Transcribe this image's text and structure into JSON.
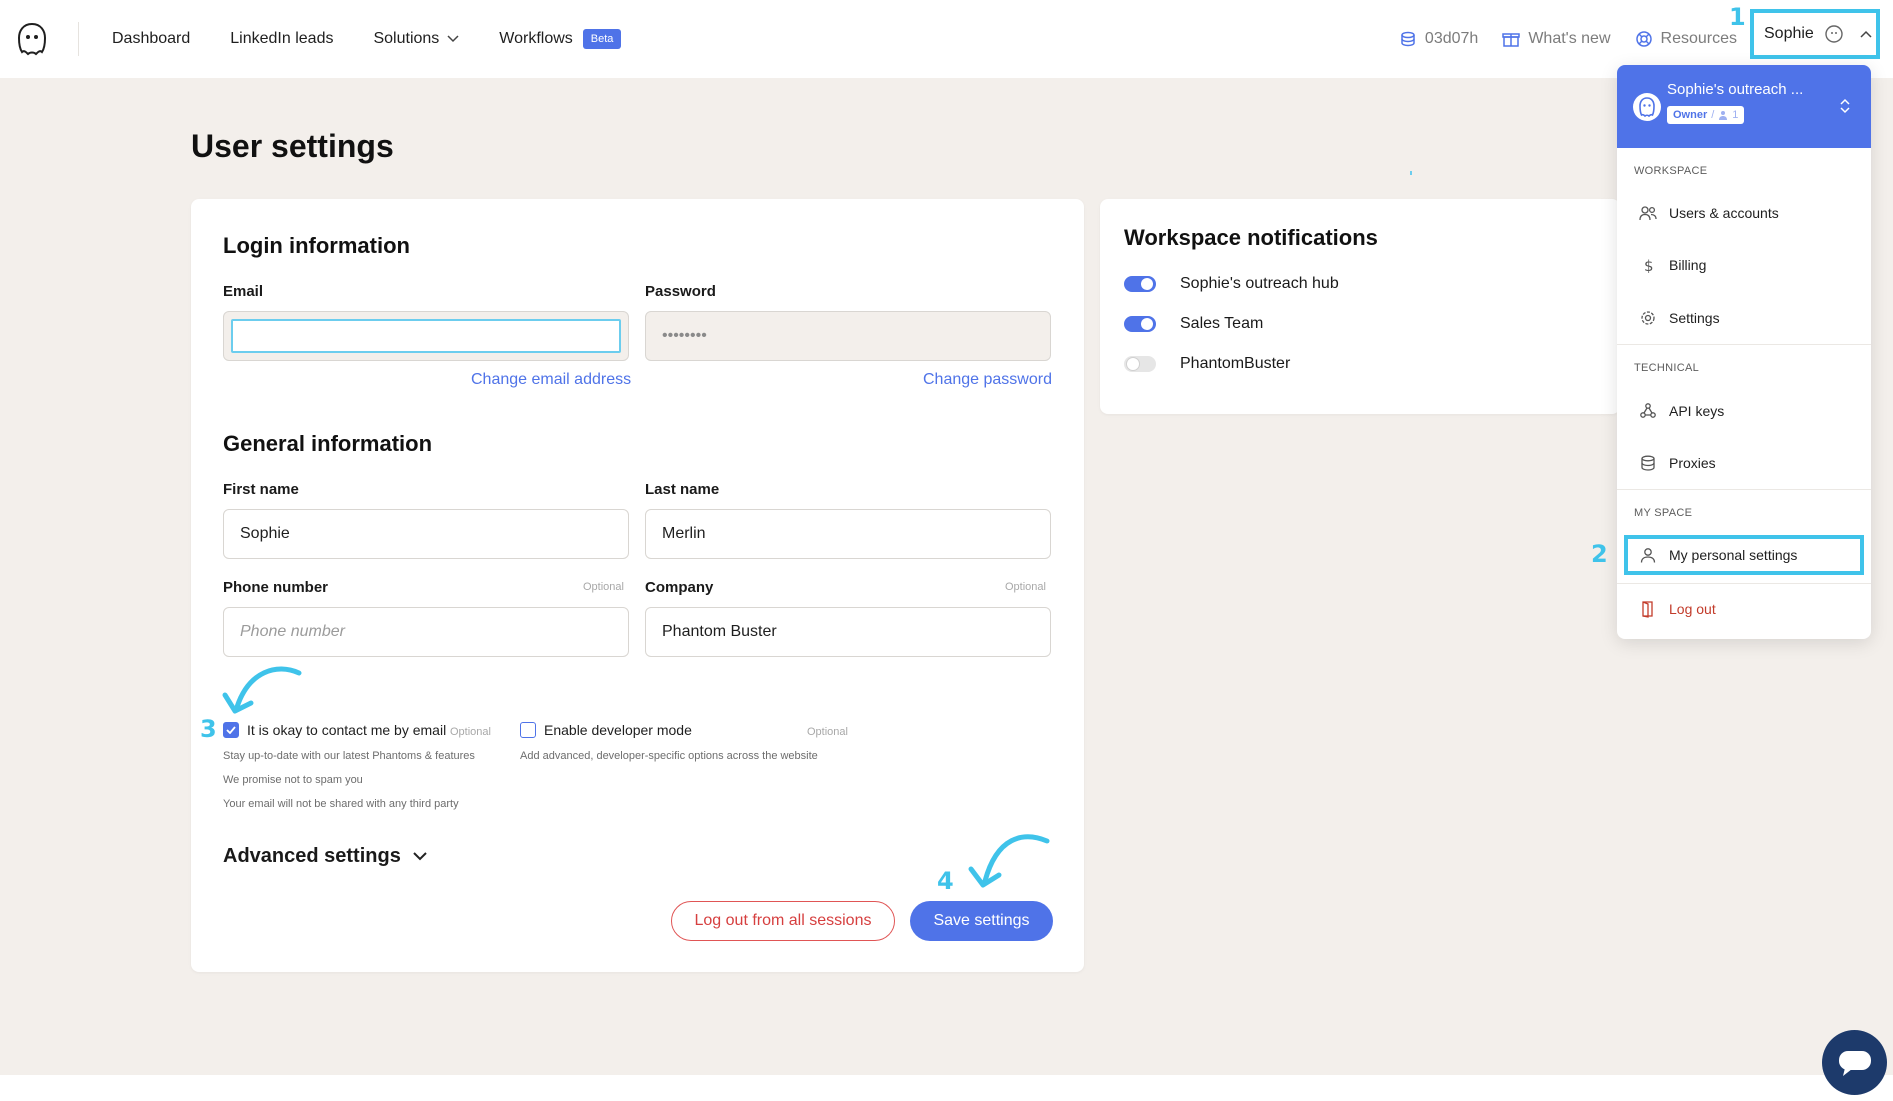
{
  "nav": {
    "links": [
      {
        "label": "Dashboard"
      },
      {
        "label": "LinkedIn leads"
      },
      {
        "label": "Solutions"
      },
      {
        "label": "Workflows",
        "badge": "Beta"
      }
    ],
    "time_remaining": "03d07h",
    "whats_new": "What's new",
    "resources": "Resources",
    "user_name": "Sophie"
  },
  "annotations": {
    "one": "1",
    "two": "2",
    "three": "3",
    "four": "4"
  },
  "page": {
    "title": "User settings"
  },
  "login": {
    "section_title": "Login information",
    "email_label": "Email",
    "email_value": "",
    "password_label": "Password",
    "password_value": "••••••••",
    "change_email": "Change email address",
    "change_password": "Change password"
  },
  "general": {
    "section_title": "General information",
    "first_name_label": "First name",
    "first_name_value": "Sophie",
    "last_name_label": "Last name",
    "last_name_value": "Merlin",
    "phone_label": "Phone number",
    "phone_optional": "Optional",
    "phone_placeholder": "Phone number",
    "company_label": "Company",
    "company_optional": "Optional",
    "company_value": "Phantom Buster",
    "contact_label": "It is okay to contact me by email",
    "contact_optional": "Optional",
    "contact_checked": true,
    "contact_help": [
      "Stay up-to-date with our latest Phantoms & features",
      "We promise not to spam you",
      "Your email will not be shared with any third party"
    ],
    "dev_label": "Enable developer mode",
    "dev_optional": "Optional",
    "dev_checked": false,
    "dev_help": "Add advanced, developer-specific options across the website",
    "advanced": "Advanced settings",
    "logout_all": "Log out from all sessions",
    "save": "Save settings"
  },
  "notifications": {
    "title": "Workspace notifications",
    "items": [
      {
        "label": "Sophie's outreach hub",
        "on": true
      },
      {
        "label": "Sales Team",
        "on": true
      },
      {
        "label": "PhantomBuster",
        "on": false
      }
    ]
  },
  "dropdown": {
    "workspace_name": "Sophie's outreach ...",
    "role": "Owner",
    "members": "1",
    "sections": {
      "workspace": "WORKSPACE",
      "technical": "TECHNICAL",
      "my_space": "MY SPACE"
    },
    "items": {
      "users": "Users & accounts",
      "billing": "Billing",
      "settings": "Settings",
      "api": "API keys",
      "proxies": "Proxies",
      "personal": "My personal settings",
      "logout": "Log out"
    }
  },
  "colors": {
    "accent": "#4f73e8",
    "annotation": "#3fc3ea",
    "danger": "#d63f3f",
    "background": "#f3efeb"
  }
}
